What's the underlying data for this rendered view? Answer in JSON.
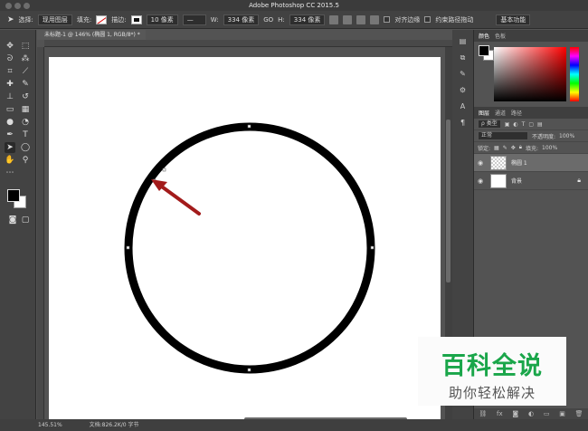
{
  "app": {
    "title": "Adobe Photoshop CC 2015.5"
  },
  "options_bar": {
    "select_label": "选择:",
    "select_value": "现用图层",
    "fill_label": "填充:",
    "stroke_label": "描边:",
    "stroke_width": "10 像素",
    "width_label": "W:",
    "width_value": "334 像素",
    "link_symbol": "GO",
    "height_label": "H:",
    "height_value": "334 像素",
    "align_edges_label": "对齐边缘",
    "constrain_path_label": "约束路径拖动",
    "workspace_value": "基本功能"
  },
  "document": {
    "tab_label": "未标题-1 @ 146% (椭圆 1, RGB/8*) *",
    "circle_stroke_color": "#000000",
    "arrow_color": "#a31b1b",
    "background_color": "#ffffff"
  },
  "status_bar": {
    "zoom": "145.51%",
    "doc_size": "文档:826.2K/0 字节"
  },
  "color_panel": {
    "tabs": [
      "颜色",
      "色板"
    ],
    "active_tab": "颜色"
  },
  "layers_panel": {
    "tabs": [
      "图层",
      "通道",
      "路径"
    ],
    "active_tab": "图层",
    "filter_label": "ρ 类型",
    "blend_mode": "正常",
    "opacity_label": "不透明度:",
    "opacity_value": "100%",
    "lock_label": "锁定:",
    "fill_label": "填充:",
    "fill_value": "100%",
    "layers": [
      {
        "name": "椭圆 1",
        "selected": true,
        "visible": true,
        "locked": false
      },
      {
        "name": "背景",
        "selected": false,
        "visible": true,
        "locked": true
      }
    ],
    "bottom_icons": [
      "link-icon",
      "fx-icon",
      "mask-icon",
      "adjustment-icon",
      "group-icon",
      "new-layer-icon",
      "trash-icon"
    ]
  },
  "watermark": {
    "logo_text": "百科全说",
    "sub_text": "助你轻松解决"
  }
}
